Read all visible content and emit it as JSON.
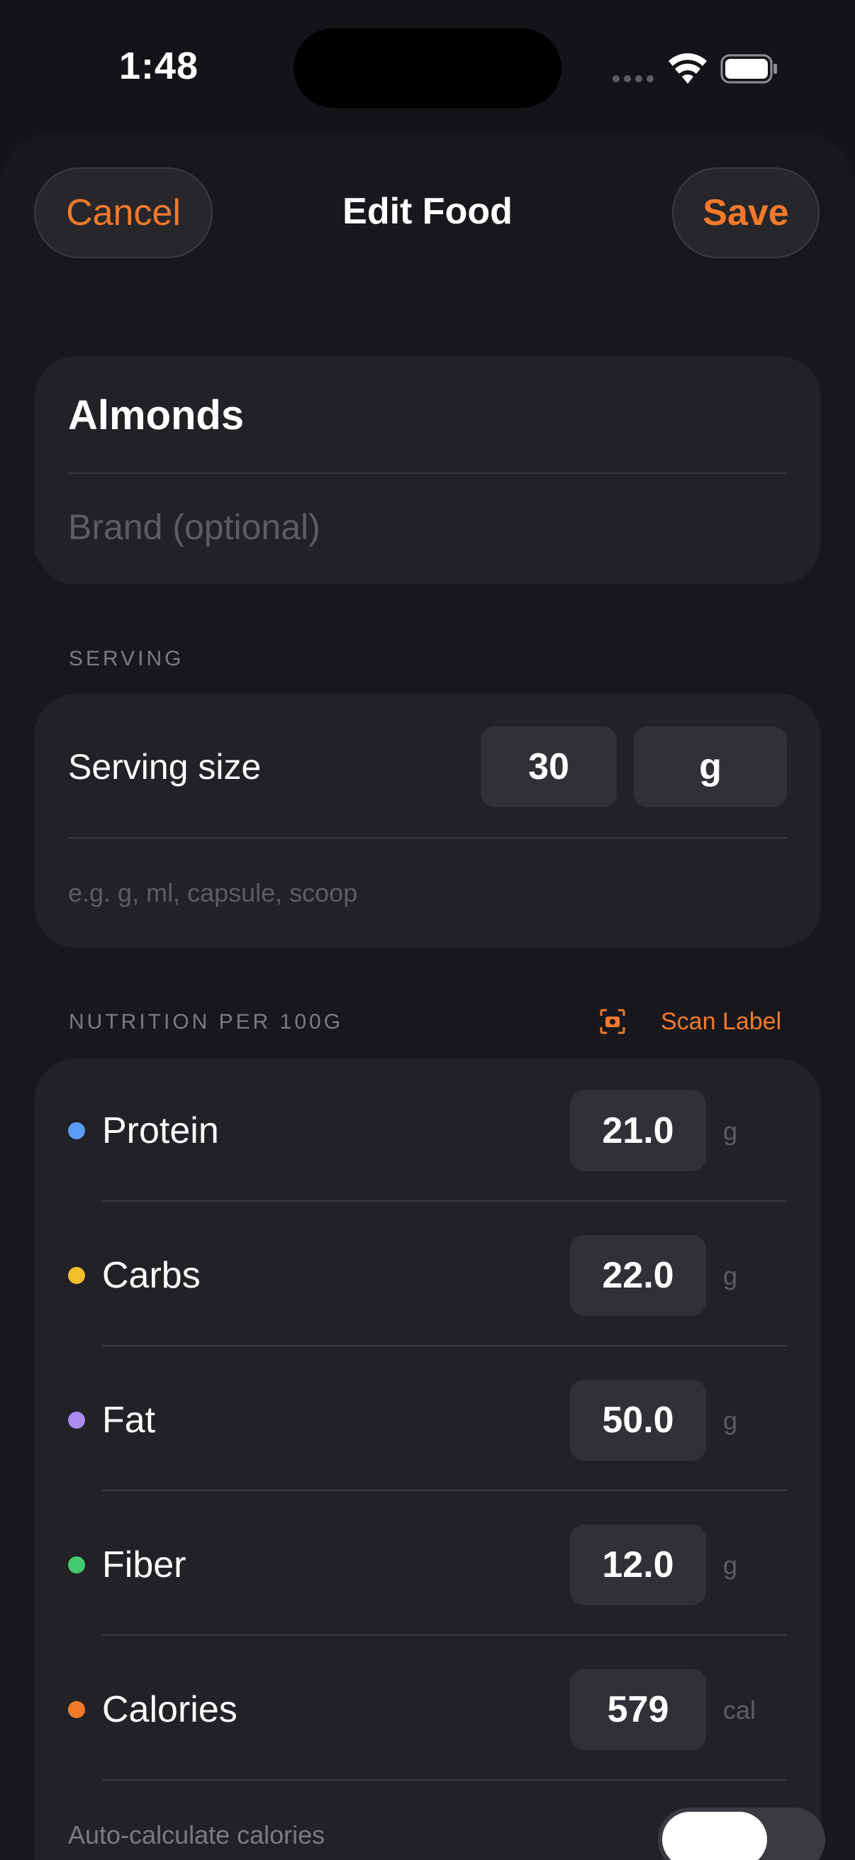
{
  "status_bar": {
    "time": "1:48"
  },
  "header": {
    "cancel_label": "Cancel",
    "title": "Edit Food",
    "save_label": "Save"
  },
  "food": {
    "name": "Almonds",
    "brand_placeholder": "Brand (optional)",
    "brand_value": ""
  },
  "serving": {
    "section_label": "SERVING",
    "size_label": "Serving size",
    "size_value": "30",
    "unit_value": "g",
    "unit_hint": "e.g. g, ml, capsule, scoop"
  },
  "nutrition": {
    "section_label": "NUTRITION PER 100G",
    "scan_label": "Scan Label",
    "rows": [
      {
        "label": "Protein",
        "value": "21.0",
        "unit": "g",
        "color": "#5b9cf5"
      },
      {
        "label": "Carbs",
        "value": "22.0",
        "unit": "g",
        "color": "#f5c02e"
      },
      {
        "label": "Fat",
        "value": "50.0",
        "unit": "g",
        "color": "#a98bf2"
      },
      {
        "label": "Fiber",
        "value": "12.0",
        "unit": "g",
        "color": "#45c96e"
      },
      {
        "label": "Calories",
        "value": "579",
        "unit": "cal",
        "color": "#f37a2b"
      }
    ],
    "auto_calc_label": "Auto-calculate calories",
    "auto_calc_on": false
  },
  "colors": {
    "accent": "#f37a2b",
    "background": "#141418",
    "card": "#222226"
  }
}
